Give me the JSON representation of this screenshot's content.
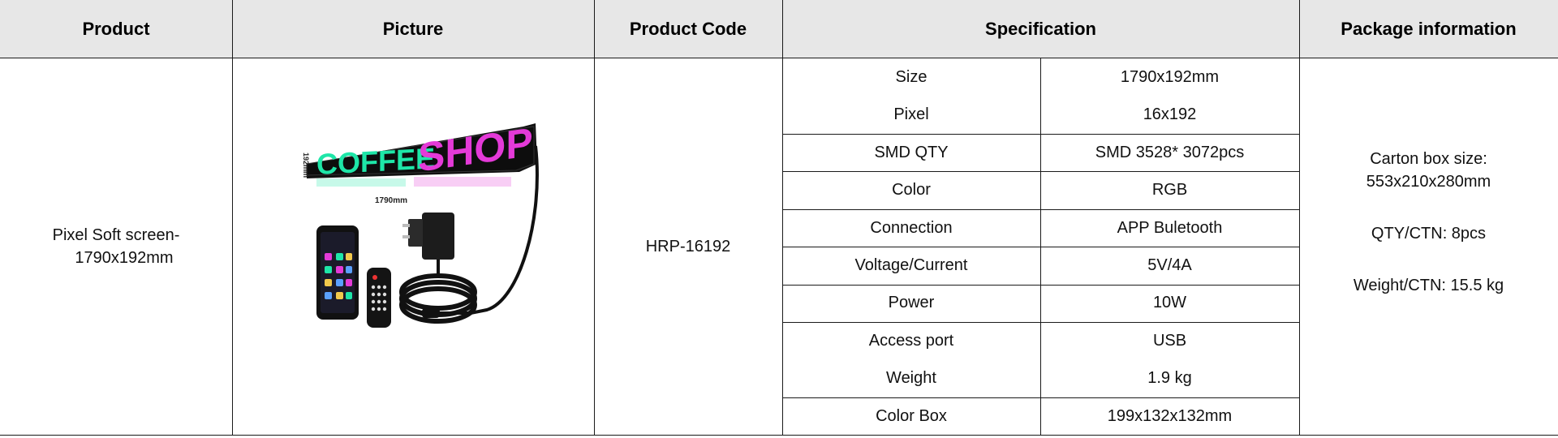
{
  "headers": {
    "product": "Product",
    "picture": "Picture",
    "product_code": "Product Code",
    "specification": "Specification",
    "package_information": "Package information"
  },
  "product": {
    "name_line1": "Pixel Soft screen-",
    "name_line2": "1790x192mm",
    "code": "HRP-16192"
  },
  "picture": {
    "sign_text_1": "COFFEE",
    "sign_text_2": "SHOP",
    "width_label": "1790mm",
    "height_label": "192mm",
    "colors": {
      "green": "#1ee6a8",
      "magenta": "#e43ad8",
      "panel": "#111111"
    }
  },
  "specs": [
    {
      "label": "Size",
      "value": "1790x192mm"
    },
    {
      "label": "Pixel",
      "value": "16x192"
    },
    {
      "label": "SMD QTY",
      "value": "SMD 3528* 3072pcs"
    },
    {
      "label": "Color",
      "value": "RGB"
    },
    {
      "label": "Connection",
      "value": "APP Buletooth"
    },
    {
      "label": "Voltage/Current",
      "value": "5V/4A"
    },
    {
      "label": "Power",
      "value": "10W"
    },
    {
      "label": "Access port",
      "value": "USB"
    },
    {
      "label": "Weight",
      "value": "1.9 kg"
    },
    {
      "label": "Color Box",
      "value": "199x132x132mm"
    }
  ],
  "package": {
    "carton_label": "Carton box size:",
    "carton_size": "553x210x280mm",
    "qty": "QTY/CTN: 8pcs",
    "weight": "Weight/CTN: 15.5 kg"
  },
  "colors": {
    "header_bg": "#e7e7e7",
    "border": "#1a1a1a"
  }
}
